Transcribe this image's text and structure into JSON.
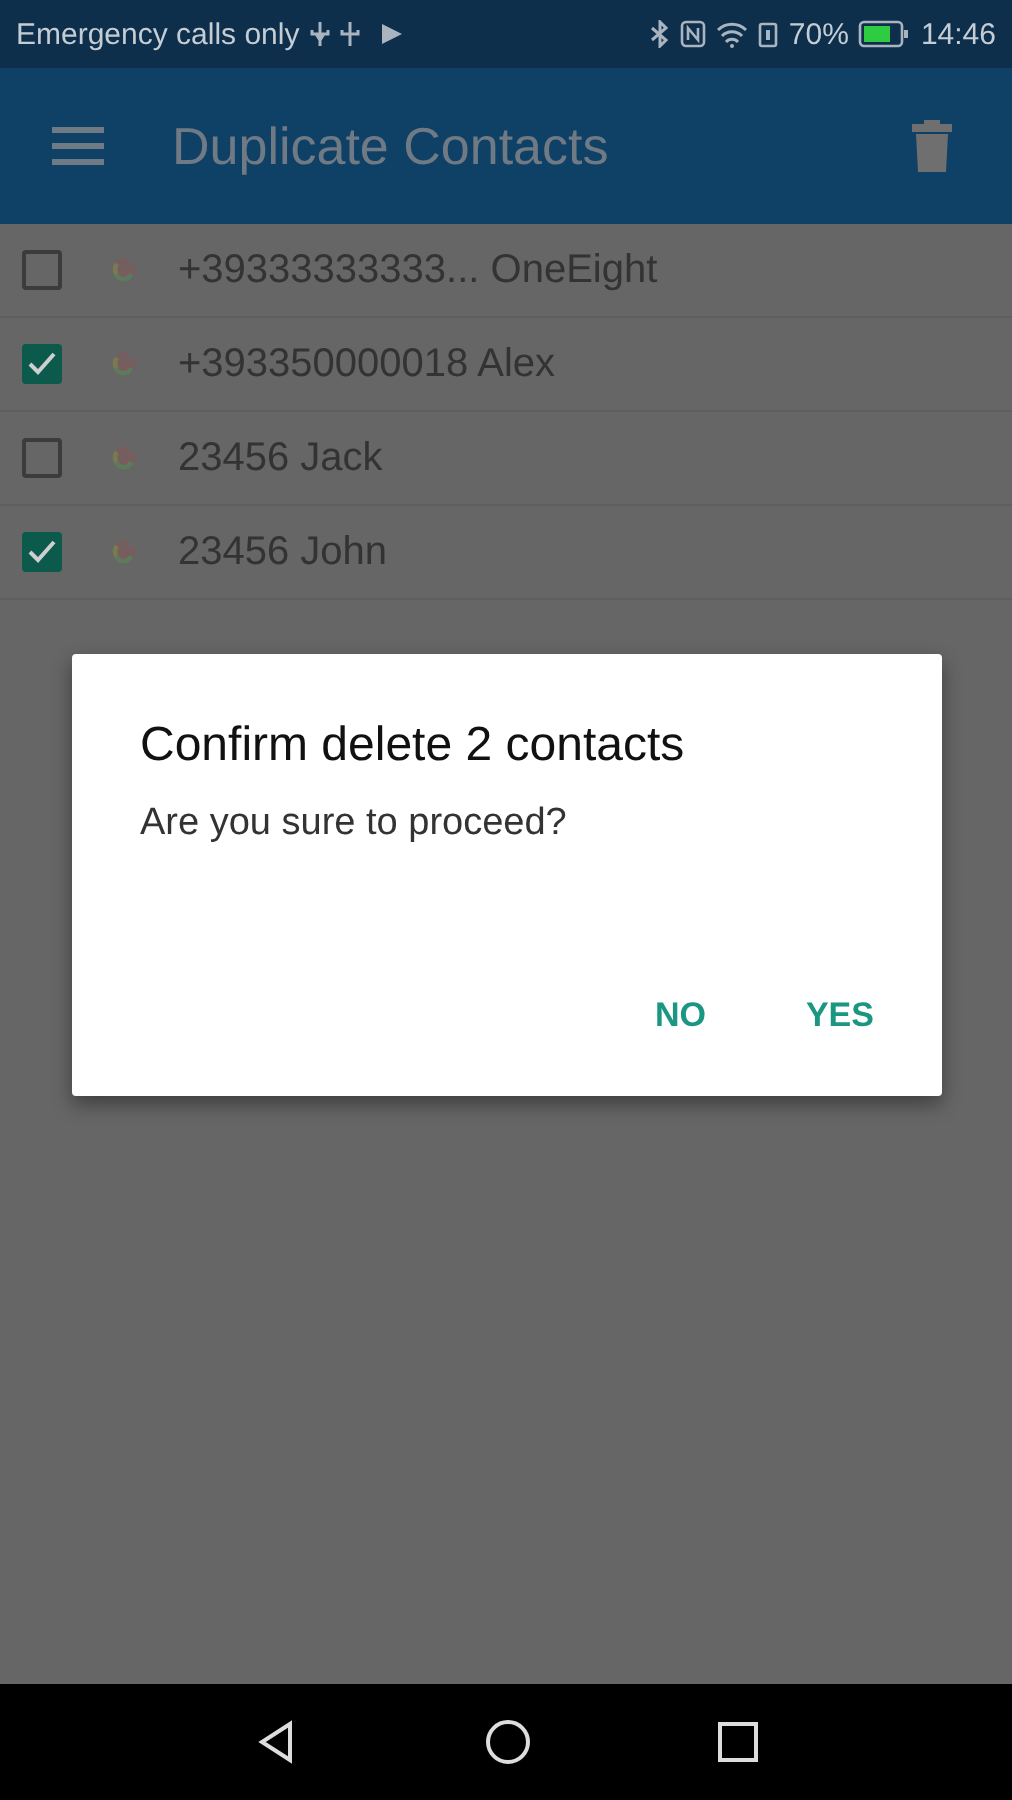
{
  "status_bar": {
    "carrier": "Emergency calls only",
    "battery": "70%",
    "time": "14:46"
  },
  "app_bar": {
    "title": "Duplicate Contacts"
  },
  "contacts": [
    {
      "label": "+39333333333... OneEight",
      "checked": false
    },
    {
      "label": "+393350000018 Alex",
      "checked": true
    },
    {
      "label": "23456 Jack",
      "checked": false
    },
    {
      "label": "23456 John",
      "checked": true
    }
  ],
  "dialog": {
    "title": "Confirm delete 2 contacts",
    "message": "Are you sure to proceed?",
    "buttons": [
      "NO",
      "YES"
    ]
  }
}
